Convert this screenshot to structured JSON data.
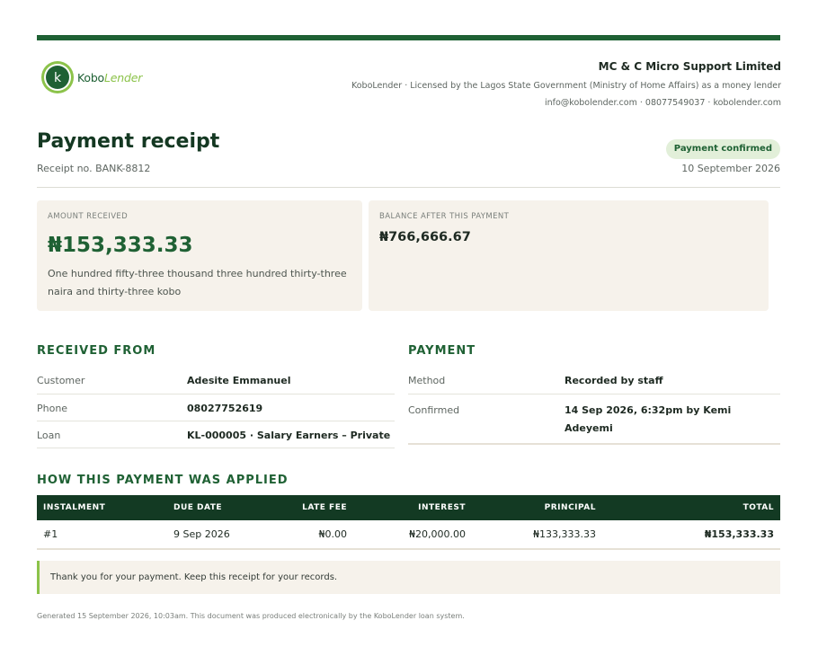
{
  "brand": {
    "logo_letter": "k",
    "name_a": "Kobo",
    "name_b": "Lender",
    "primary_color": "#1f6134",
    "accent_color": "#8cc34a",
    "header_color": "#133a23",
    "card_color": "#f6f2eb"
  },
  "company": {
    "name": "MC & C Micro Support Limited",
    "license": "KoboLender · Licensed by the Lagos State Government (Ministry of Home Affairs) as a money lender",
    "contact": "info@kobolender.com · 08077549037 · kobolender.com"
  },
  "receipt": {
    "title": "Payment receipt",
    "number": "Receipt no. BANK-8812",
    "status": "Payment confirmed",
    "date": "10 September 2026"
  },
  "amount": {
    "label": "AMOUNT RECEIVED",
    "value": "₦153,333.33",
    "words": "One hundred fifty-three thousand three hundred thirty-three naira and thirty-three kobo"
  },
  "balance": {
    "label": "BALANCE AFTER THIS PAYMENT",
    "value": "₦766,666.67"
  },
  "received_from": {
    "heading": "RECEIVED FROM",
    "rows": [
      {
        "label": "Customer",
        "value": "Adesite Emmanuel"
      },
      {
        "label": "Phone",
        "value": "08027752619"
      },
      {
        "label": "Loan",
        "value": "KL-000005 · Salary Earners – Private"
      }
    ]
  },
  "payment": {
    "heading": "PAYMENT",
    "rows": [
      {
        "label": "Method",
        "value": "Recorded by staff"
      },
      {
        "label": "Confirmed",
        "value": "14 Sep 2026, 6:32pm by Kemi Adeyemi"
      }
    ]
  },
  "allocation": {
    "heading": "HOW THIS PAYMENT WAS APPLIED",
    "columns": [
      "INSTALMENT",
      "DUE DATE",
      "LATE FEE",
      "INTEREST",
      "PRINCIPAL",
      "TOTAL"
    ],
    "rows": [
      [
        "#1",
        "9 Sep 2026",
        "₦0.00",
        "₦20,000.00",
        "₦133,333.33",
        "₦153,333.33"
      ]
    ]
  },
  "note": "Thank you for your payment. Keep this receipt for your records.",
  "footer": "Generated 15 September 2026, 10:03am. This document was produced electronically by the KoboLender loan system."
}
